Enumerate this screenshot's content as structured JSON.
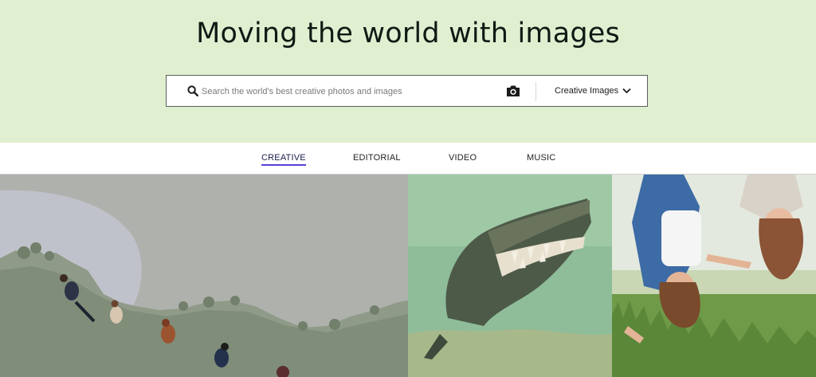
{
  "hero": {
    "title": "Moving the world with images",
    "background_color": "#e0efd0"
  },
  "search": {
    "placeholder": "Search the world's best creative photos and images",
    "search_icon": "search-icon",
    "camera_icon": "camera-icon",
    "dropdown_value": "Creative Images",
    "dropdown_icon": "chevron-down-icon"
  },
  "tabs": [
    {
      "label": "CREATIVE",
      "active": true
    },
    {
      "label": "EDITORIAL",
      "active": false
    },
    {
      "label": "VIDEO",
      "active": false
    },
    {
      "label": "MUSIC",
      "active": false
    }
  ],
  "colors": {
    "accent_underline": "#5b3fd6"
  }
}
